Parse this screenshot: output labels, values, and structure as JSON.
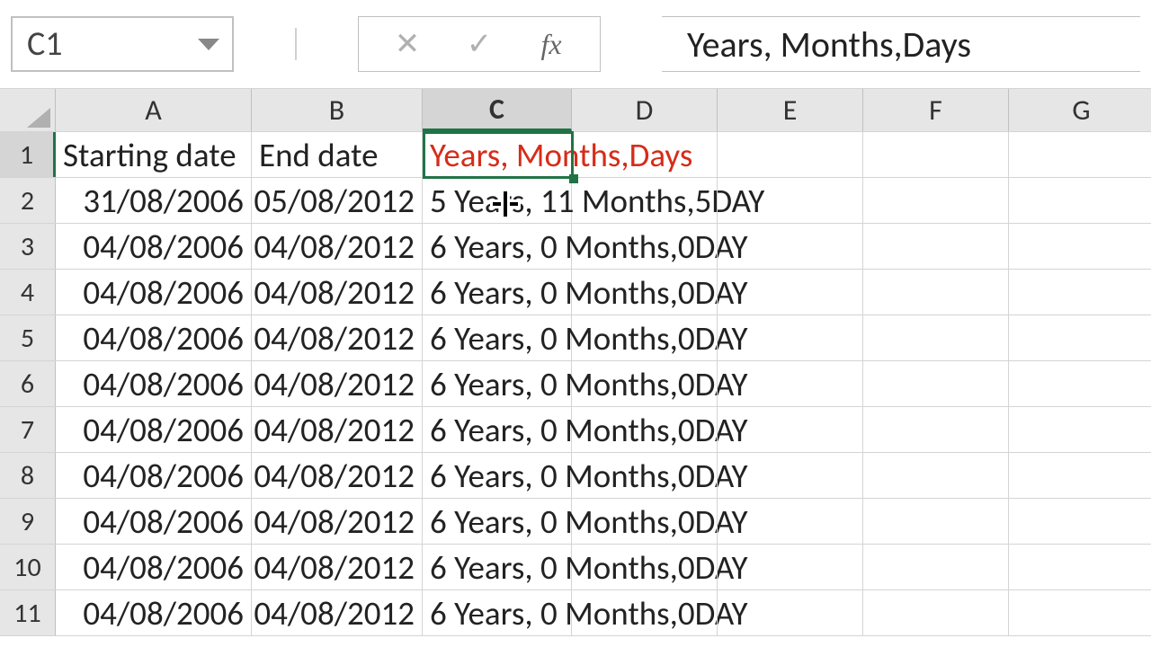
{
  "nameBox": "C1",
  "formulaBar": "Years, Months,Days",
  "columns": [
    "A",
    "B",
    "C",
    "D",
    "E",
    "F",
    "G"
  ],
  "activeCol": "C",
  "activeRow": "1",
  "headerRow": {
    "A": "Starting date",
    "B": "End date",
    "C": "Years, Months,Days"
  },
  "rows": [
    {
      "n": "2",
      "A": "31/08/2006",
      "B": "05/08/2012",
      "C": "5 Years, 11 Months,5DAY"
    },
    {
      "n": "3",
      "A": "04/08/2006",
      "B": "04/08/2012",
      "C": "6 Years, 0 Months,0DAY"
    },
    {
      "n": "4",
      "A": "04/08/2006",
      "B": "04/08/2012",
      "C": "6 Years, 0 Months,0DAY"
    },
    {
      "n": "5",
      "A": "04/08/2006",
      "B": "04/08/2012",
      "C": "6 Years, 0 Months,0DAY"
    },
    {
      "n": "6",
      "A": "04/08/2006",
      "B": "04/08/2012",
      "C": "6 Years, 0 Months,0DAY"
    },
    {
      "n": "7",
      "A": "04/08/2006",
      "B": "04/08/2012",
      "C": "6 Years, 0 Months,0DAY"
    },
    {
      "n": "8",
      "A": "04/08/2006",
      "B": "04/08/2012",
      "C": "6 Years, 0 Months,0DAY"
    },
    {
      "n": "9",
      "A": "04/08/2006",
      "B": "04/08/2012",
      "C": "6 Years, 0 Months,0DAY"
    },
    {
      "n": "10",
      "A": "04/08/2006",
      "B": "04/08/2012",
      "C": "6 Years, 0 Months,0DAY"
    },
    {
      "n": "11",
      "A": "04/08/2006",
      "B": "04/08/2012",
      "C": "6 Years, 0 Months,0DAY"
    }
  ],
  "icons": {
    "cancel": "✕",
    "enter": "✓",
    "fx": "fx"
  }
}
